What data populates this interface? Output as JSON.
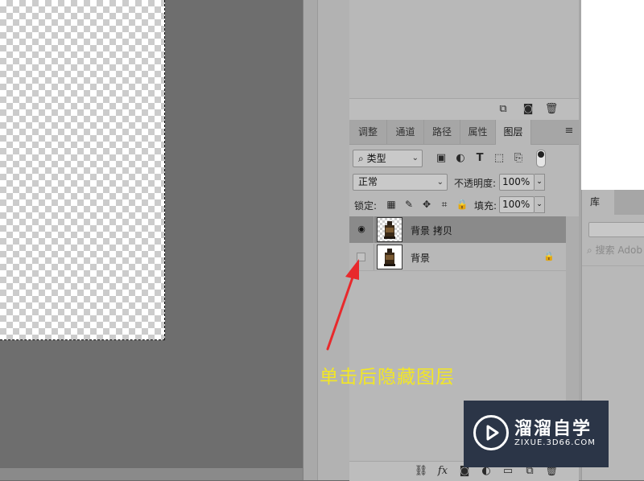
{
  "top_panel": {
    "bottom_icons": [
      "new-snapshot-icon",
      "camera-icon",
      "trash-icon"
    ]
  },
  "layers_panel": {
    "tabs": [
      {
        "label": "调整",
        "active": false
      },
      {
        "label": "通道",
        "active": false
      },
      {
        "label": "路径",
        "active": false
      },
      {
        "label": "属性",
        "active": false
      },
      {
        "label": "图层",
        "active": true
      }
    ],
    "filter_type": "类型",
    "blend_mode": "正常",
    "opacity_label": "不透明度:",
    "opacity_value": "100%",
    "lock_label": "锁定:",
    "fill_label": "填充:",
    "fill_value": "100%",
    "layers": [
      {
        "name": "背景 拷贝",
        "visible": true,
        "selected": true,
        "locked": false
      },
      {
        "name": "背景",
        "visible": false,
        "selected": false,
        "locked": true
      }
    ],
    "bottom_icons": [
      "link-icon",
      "fx-icon",
      "mask-icon",
      "adjustment-icon",
      "group-icon",
      "new-layer-icon",
      "trash-icon"
    ]
  },
  "library_panel": {
    "tab": "库",
    "search_placeholder": "搜索 Adob"
  },
  "annotation": {
    "text": "单击后隐藏图层",
    "color": "#f2e626",
    "arrow_color": "#e8292c"
  },
  "watermark": {
    "title": "溜溜自学",
    "url": "ZIXUE.3D66.COM"
  }
}
